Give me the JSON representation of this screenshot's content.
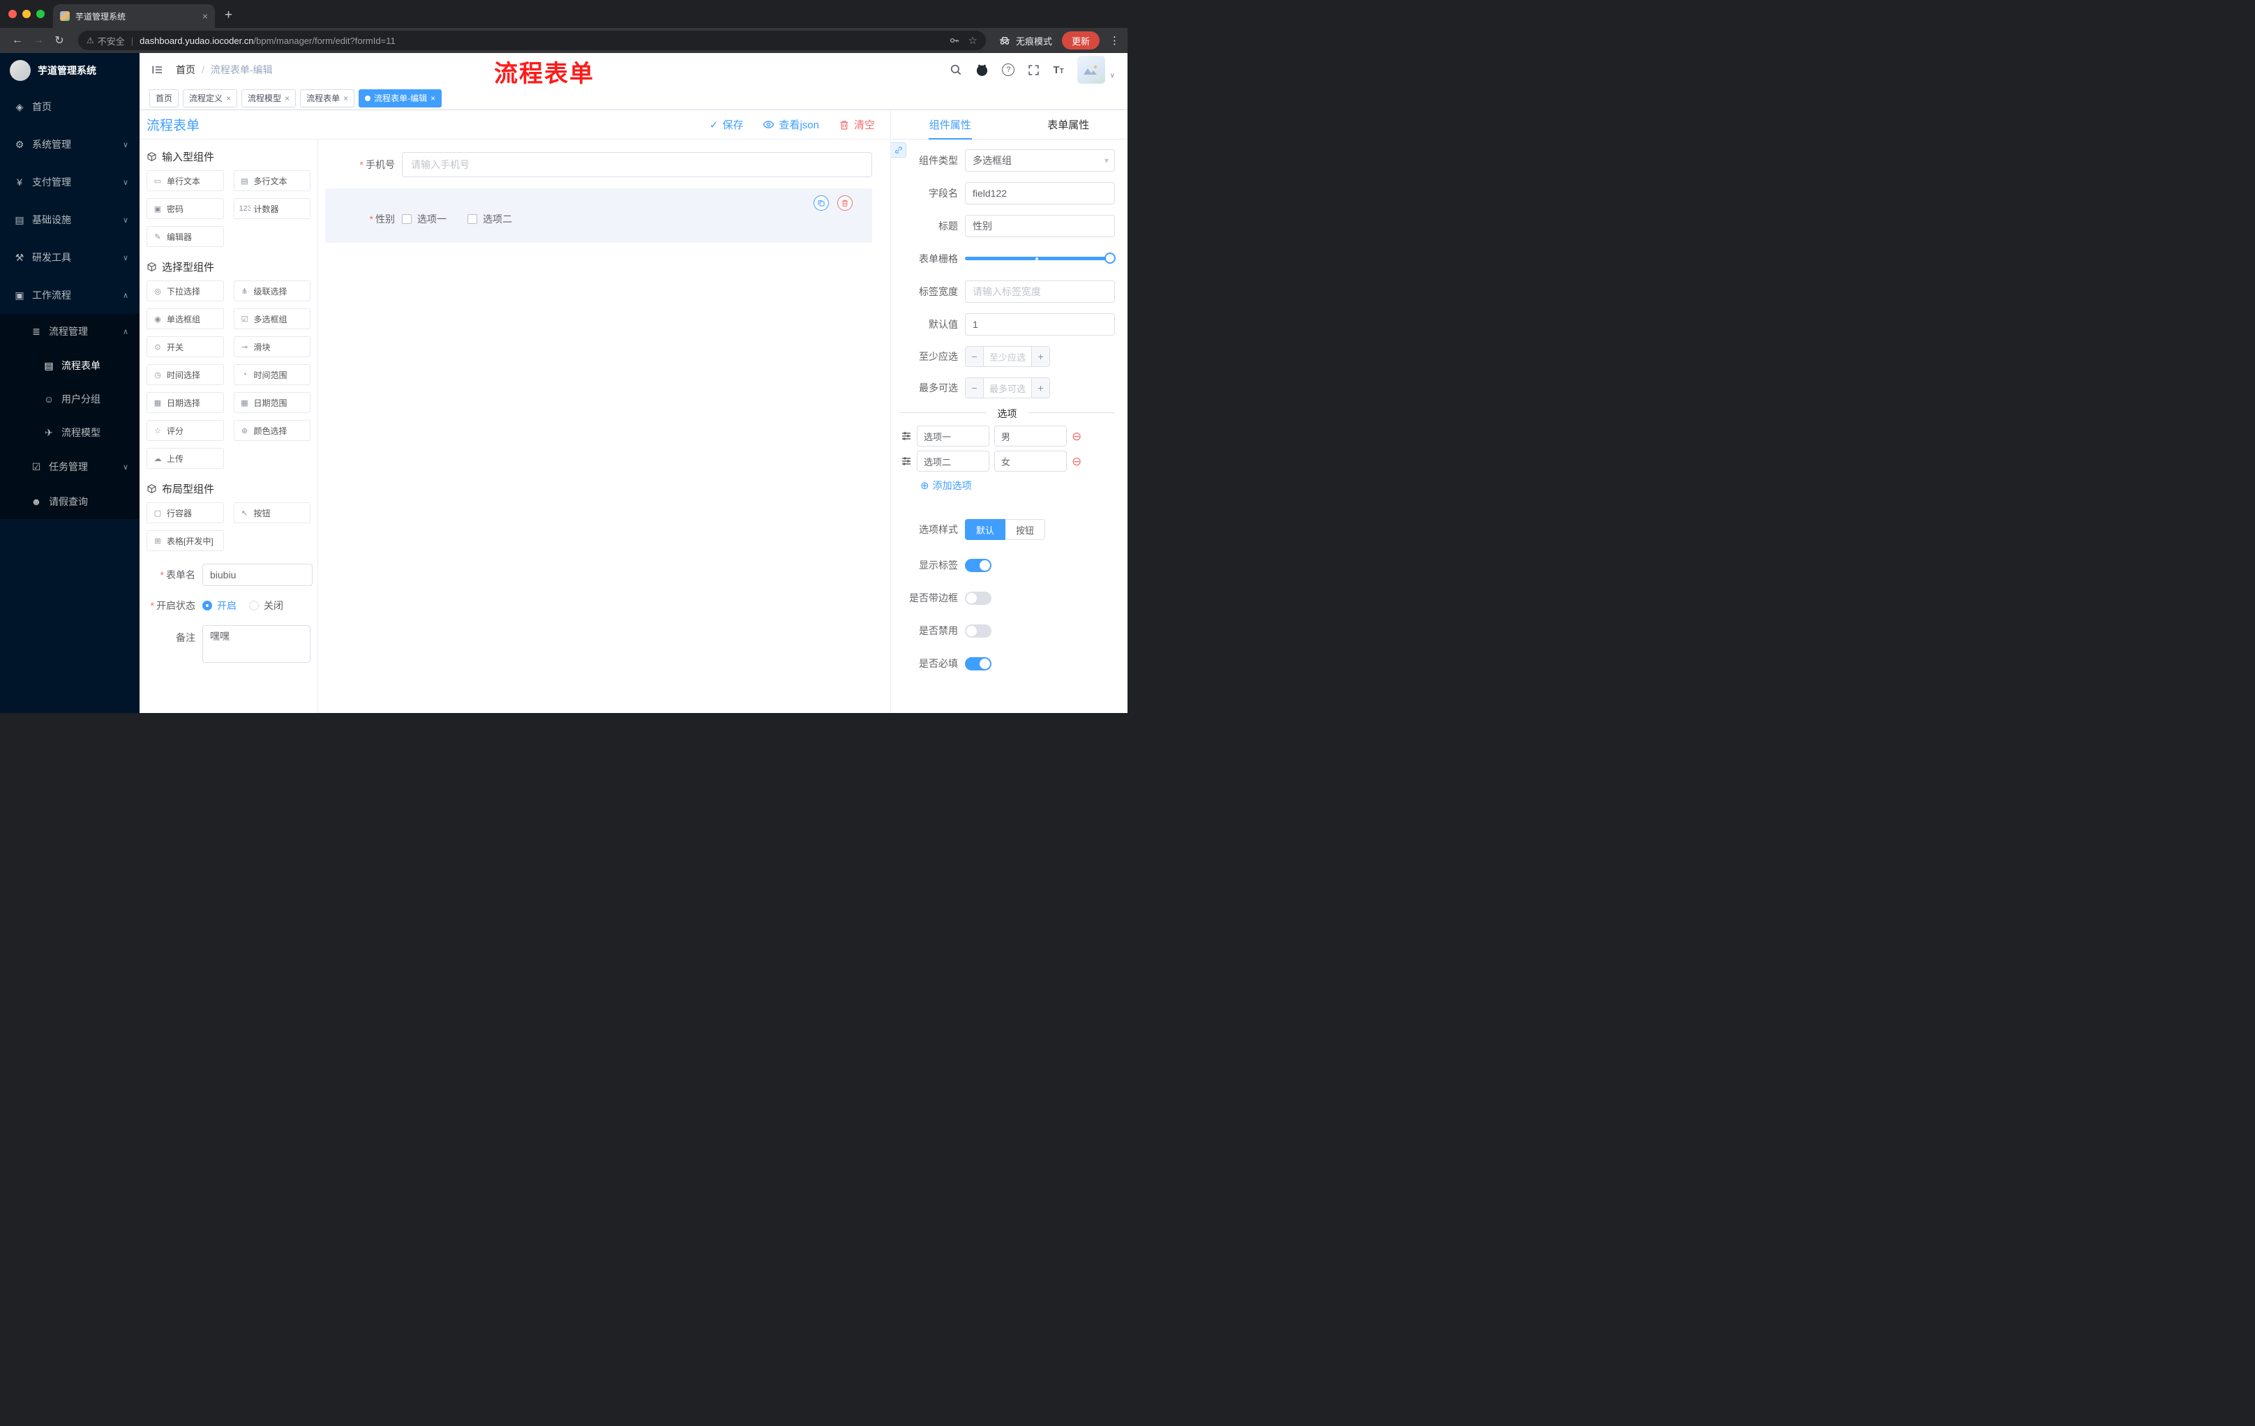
{
  "colors": {
    "accent": "#409eff",
    "danger": "#f56c6c",
    "sidebar_bg": "#001529",
    "annotation": "#ff1a1a"
  },
  "browser": {
    "tab_title": "芋道管理系统",
    "security_label": "不安全",
    "url_domain": "dashboard.yudao.iocoder.cn",
    "url_path": "/bpm/manager/form/edit?formId=11",
    "incognito_label": "无痕模式",
    "update_label": "更新"
  },
  "annotation_text": "流程表单",
  "sidebar": {
    "app_title": "芋道管理系统",
    "menu": [
      {
        "label": "首页",
        "icon": "◈"
      },
      {
        "label": "系统管理",
        "icon": "⚙",
        "arrow": "∨"
      },
      {
        "label": "支付管理",
        "icon": "¥",
        "arrow": "∨"
      },
      {
        "label": "基础设施",
        "icon": "▤",
        "arrow": "∨"
      },
      {
        "label": "研发工具",
        "icon": "⚒",
        "arrow": "∨"
      },
      {
        "label": "工作流程",
        "icon": "▣",
        "arrow": "∧"
      },
      {
        "label": "流程管理",
        "icon": "≣",
        "arrow": "∧"
      },
      {
        "label": "流程表单",
        "icon": "▤"
      },
      {
        "label": "用户分组",
        "icon": "☺"
      },
      {
        "label": "流程模型",
        "icon": "✈"
      },
      {
        "label": "任务管理",
        "icon": "☑",
        "arrow": "∨"
      },
      {
        "label": "请假查询",
        "icon": "☻"
      }
    ]
  },
  "header": {
    "breadcrumb_home": "首页",
    "breadcrumb_sep": "/",
    "breadcrumb_current": "流程表单-编辑"
  },
  "tags": [
    {
      "label": "首页"
    },
    {
      "label": "流程定义"
    },
    {
      "label": "流程模型"
    },
    {
      "label": "流程表单"
    },
    {
      "label": "流程表单-编辑"
    }
  ],
  "toolbar": {
    "title": "流程表单",
    "save": "保存",
    "view_json": "查看json",
    "clear": "清空"
  },
  "palette": {
    "sections": [
      {
        "title": "输入型组件",
        "items": [
          {
            "label": "单行文本",
            "icon": "▭"
          },
          {
            "label": "多行文本",
            "icon": "▤"
          },
          {
            "label": "密码",
            "icon": "▣"
          },
          {
            "label": "计数器",
            "icon": "123"
          },
          {
            "label": "编辑器",
            "icon": "✎"
          }
        ]
      },
      {
        "title": "选择型组件",
        "items": [
          {
            "label": "下拉选择",
            "icon": "◎"
          },
          {
            "label": "级联选择",
            "icon": "⋔"
          },
          {
            "label": "单选框组",
            "icon": "◉"
          },
          {
            "label": "多选框组",
            "icon": "☑"
          },
          {
            "label": "开关",
            "icon": "⊙"
          },
          {
            "label": "滑块",
            "icon": "⊸"
          },
          {
            "label": "时间选择",
            "icon": "◷"
          },
          {
            "label": "时间范围",
            "icon": "◔"
          },
          {
            "label": "日期选择",
            "icon": "▦"
          },
          {
            "label": "日期范围",
            "icon": "▦"
          },
          {
            "label": "评分",
            "icon": "☆"
          },
          {
            "label": "颜色选择",
            "icon": "⊛"
          },
          {
            "label": "上传",
            "icon": "☁"
          }
        ]
      },
      {
        "title": "布局型组件",
        "items": [
          {
            "label": "行容器",
            "icon": "▢"
          },
          {
            "label": "按钮",
            "icon": "↖"
          },
          {
            "label": "表格[开发中]",
            "icon": "⊞"
          }
        ]
      }
    ]
  },
  "meta_form": {
    "name_label": "表单名",
    "name_value": "biubiu",
    "status_label": "开启状态",
    "status_on": "开启",
    "status_off": "关闭",
    "remark_label": "备注",
    "remark_value": "嘿嘿"
  },
  "canvas": {
    "phone_label": "手机号",
    "phone_placeholder": "请输入手机号",
    "gender_label": "性别",
    "gender_opt1": "选项一",
    "gender_opt2": "选项二"
  },
  "inspector": {
    "tab_component": "组件属性",
    "tab_form": "表单属性",
    "rows": {
      "type_label": "组件类型",
      "type_value": "多选框组",
      "field_label": "字段名",
      "field_value": "field122",
      "title_label": "标题",
      "title_value": "性别",
      "grid_label": "表单栅格",
      "width_label": "标签宽度",
      "width_placeholder": "请输入标签宽度",
      "default_label": "默认值",
      "default_value": "1",
      "min_label": "至少应选",
      "min_placeholder": "至少应选",
      "max_label": "最多可选",
      "max_placeholder": "最多可选"
    },
    "options_divider": "选项",
    "options": [
      {
        "label": "选项一",
        "value": "男"
      },
      {
        "label": "选项二",
        "value": "女"
      }
    ],
    "add_option": "添加选项",
    "style_label": "选项样式",
    "style_default": "默认",
    "style_button": "按钮",
    "switch_show_label": "显示标签",
    "switch_border": "是否带边框",
    "switch_disabled": "是否禁用",
    "switch_required": "是否必填"
  }
}
